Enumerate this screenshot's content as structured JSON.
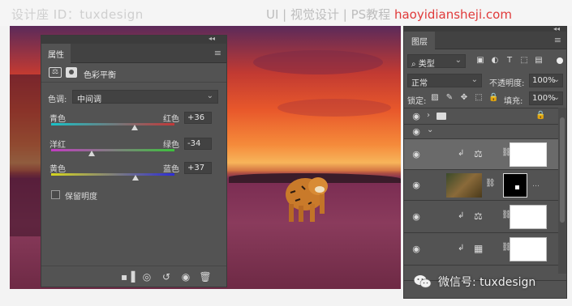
{
  "watermark": {
    "left": "设计座 ID：tuxdesign",
    "right_prefix": "UI | 视觉设计 | PS教程",
    "right_url": "haoyidiansheji.com"
  },
  "properties_panel": {
    "tab": "属性",
    "adjustment_title": "色彩平衡",
    "tone_label": "色调:",
    "tone_value": "中间调",
    "sliders": [
      {
        "left": "青色",
        "right": "红色",
        "value": "+36",
        "position": 0.68
      },
      {
        "left": "洋红",
        "right": "绿色",
        "value": "-34",
        "position": 0.33
      },
      {
        "left": "黄色",
        "right": "蓝色",
        "value": "+37",
        "position": 0.685
      }
    ],
    "preserve_luminosity": "保留明度"
  },
  "layers_panel": {
    "tab": "图层",
    "filter_kind": "类型",
    "blend_mode": "正常",
    "opacity_label": "不透明度:",
    "opacity_value": "100%",
    "lock_label": "锁定:",
    "fill_label": "填充:",
    "fill_value": "100%"
  },
  "watermark_bottom": "微信号: tuxdesign"
}
